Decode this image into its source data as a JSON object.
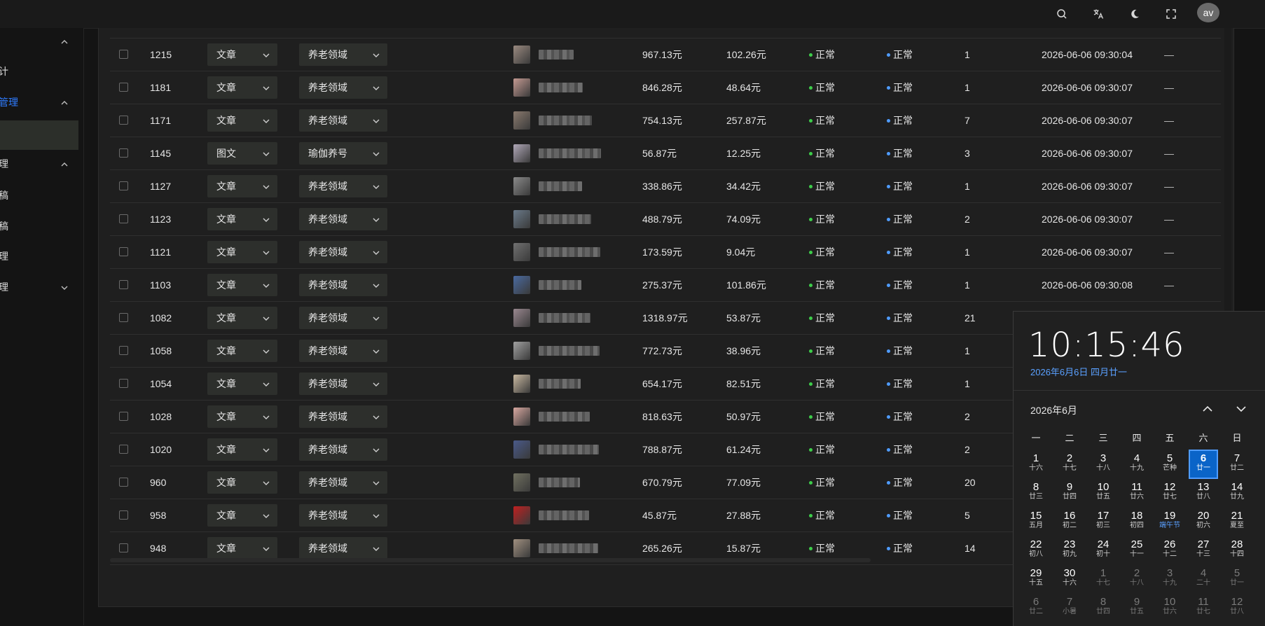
{
  "header": {
    "avatar_text": "av",
    "icons": [
      "search-icon",
      "translate-icon",
      "moon-icon",
      "fullscreen-icon"
    ]
  },
  "sidebar": {
    "items": [
      {
        "label": "",
        "chevron": "up"
      },
      {
        "label": "计",
        "chevron": ""
      },
      {
        "label": "管理",
        "chevron": "up",
        "active": true
      },
      {
        "label": "",
        "chevron": "",
        "selected": true
      },
      {
        "label": "理",
        "chevron": "up"
      },
      {
        "label": "稿",
        "chevron": ""
      },
      {
        "label": "稿",
        "chevron": ""
      },
      {
        "label": "理",
        "chevron": ""
      },
      {
        "label": "理",
        "chevron": "down"
      }
    ]
  },
  "table": {
    "rows": [
      {
        "id": "1215",
        "type": "文章",
        "domain": "养老领域",
        "price": "967.13元",
        "amount": "102.26元",
        "status1": "正常",
        "status2": "正常",
        "count": "1",
        "time": "2026-06-06 09:30:04",
        "extra": "—"
      },
      {
        "id": "1181",
        "type": "文章",
        "domain": "养老领域",
        "price": "846.28元",
        "amount": "48.64元",
        "status1": "正常",
        "status2": "正常",
        "count": "1",
        "time": "2026-06-06 09:30:07",
        "extra": "—"
      },
      {
        "id": "1171",
        "type": "文章",
        "domain": "养老领域",
        "price": "754.13元",
        "amount": "257.87元",
        "status1": "正常",
        "status2": "正常",
        "count": "7",
        "time": "2026-06-06 09:30:07",
        "extra": "—"
      },
      {
        "id": "1145",
        "type": "图文",
        "domain": "瑜伽养号",
        "price": "56.87元",
        "amount": "12.25元",
        "status1": "正常",
        "status2": "正常",
        "count": "3",
        "time": "2026-06-06 09:30:07",
        "extra": "—"
      },
      {
        "id": "1127",
        "type": "文章",
        "domain": "养老领域",
        "price": "338.86元",
        "amount": "34.42元",
        "status1": "正常",
        "status2": "正常",
        "count": "1",
        "time": "2026-06-06 09:30:07",
        "extra": "—"
      },
      {
        "id": "1123",
        "type": "文章",
        "domain": "养老领域",
        "price": "488.79元",
        "amount": "74.09元",
        "status1": "正常",
        "status2": "正常",
        "count": "2",
        "time": "2026-06-06 09:30:07",
        "extra": "—"
      },
      {
        "id": "1121",
        "type": "文章",
        "domain": "养老领域",
        "price": "173.59元",
        "amount": "9.04元",
        "status1": "正常",
        "status2": "正常",
        "count": "1",
        "time": "2026-06-06 09:30:07",
        "extra": "—"
      },
      {
        "id": "1103",
        "type": "文章",
        "domain": "养老领域",
        "price": "275.37元",
        "amount": "101.86元",
        "status1": "正常",
        "status2": "正常",
        "count": "1",
        "time": "2026-06-06 09:30:08",
        "extra": "—"
      },
      {
        "id": "1082",
        "type": "文章",
        "domain": "养老领域",
        "price": "1318.97元",
        "amount": "53.87元",
        "status1": "正常",
        "status2": "正常",
        "count": "21",
        "time": "",
        "extra": ""
      },
      {
        "id": "1058",
        "type": "文章",
        "domain": "养老领域",
        "price": "772.73元",
        "amount": "38.96元",
        "status1": "正常",
        "status2": "正常",
        "count": "1",
        "time": "",
        "extra": ""
      },
      {
        "id": "1054",
        "type": "文章",
        "domain": "养老领域",
        "price": "654.17元",
        "amount": "82.51元",
        "status1": "正常",
        "status2": "正常",
        "count": "1",
        "time": "",
        "extra": ""
      },
      {
        "id": "1028",
        "type": "文章",
        "domain": "养老领域",
        "price": "818.63元",
        "amount": "50.97元",
        "status1": "正常",
        "status2": "正常",
        "count": "2",
        "time": "",
        "extra": ""
      },
      {
        "id": "1020",
        "type": "文章",
        "domain": "养老领域",
        "price": "788.87元",
        "amount": "61.24元",
        "status1": "正常",
        "status2": "正常",
        "count": "2",
        "time": "",
        "extra": ""
      },
      {
        "id": "960",
        "type": "文章",
        "domain": "养老领域",
        "price": "670.79元",
        "amount": "77.09元",
        "status1": "正常",
        "status2": "正常",
        "count": "20",
        "time": "",
        "extra": ""
      },
      {
        "id": "958",
        "type": "文章",
        "domain": "养老领域",
        "price": "45.87元",
        "amount": "27.88元",
        "status1": "正常",
        "status2": "正常",
        "count": "5",
        "time": "",
        "extra": ""
      },
      {
        "id": "948",
        "type": "文章",
        "domain": "养老领域",
        "price": "265.26元",
        "amount": "15.87元",
        "status1": "正常",
        "status2": "正常",
        "count": "14",
        "time": "",
        "extra": ""
      }
    ],
    "thumb_colors": [
      "#9a8a80",
      "#c49a92",
      "#8a7a6e",
      "#b0a8b8",
      "#8a8a8a",
      "#6a7a8a",
      "#707070",
      "#4a6aa0",
      "#9a8890",
      "#a0a0a0",
      "#c8b8a0",
      "#d8a8a0",
      "#4a5a8a",
      "#707060",
      "#c02020",
      "#a09080"
    ],
    "status_colors": {
      "green": "#3dcc4a",
      "blue": "#4f9cff"
    }
  },
  "calendar": {
    "time": "10:15:46",
    "date_line": "2026年6月6日 四月廿一",
    "month_label": "2026年6月",
    "weekdays": [
      "一",
      "二",
      "三",
      "四",
      "五",
      "六",
      "日"
    ],
    "weeks": [
      [
        {
          "d": "1",
          "l": "十六"
        },
        {
          "d": "2",
          "l": "十七"
        },
        {
          "d": "3",
          "l": "十八"
        },
        {
          "d": "4",
          "l": "十九"
        },
        {
          "d": "5",
          "l": "芒种"
        },
        {
          "d": "6",
          "l": "廿一",
          "today": true
        },
        {
          "d": "7",
          "l": "廿二"
        }
      ],
      [
        {
          "d": "8",
          "l": "廿三"
        },
        {
          "d": "9",
          "l": "廿四"
        },
        {
          "d": "10",
          "l": "廿五"
        },
        {
          "d": "11",
          "l": "廿六"
        },
        {
          "d": "12",
          "l": "廿七"
        },
        {
          "d": "13",
          "l": "廿八"
        },
        {
          "d": "14",
          "l": "廿九"
        }
      ],
      [
        {
          "d": "15",
          "l": "五月"
        },
        {
          "d": "16",
          "l": "初二"
        },
        {
          "d": "17",
          "l": "初三"
        },
        {
          "d": "18",
          "l": "初四"
        },
        {
          "d": "19",
          "l": "端午节",
          "fest": true
        },
        {
          "d": "20",
          "l": "初六"
        },
        {
          "d": "21",
          "l": "夏至"
        }
      ],
      [
        {
          "d": "22",
          "l": "初八"
        },
        {
          "d": "23",
          "l": "初九"
        },
        {
          "d": "24",
          "l": "初十"
        },
        {
          "d": "25",
          "l": "十一"
        },
        {
          "d": "26",
          "l": "十二"
        },
        {
          "d": "27",
          "l": "十三"
        },
        {
          "d": "28",
          "l": "十四"
        }
      ],
      [
        {
          "d": "29",
          "l": "十五"
        },
        {
          "d": "30",
          "l": "十六"
        },
        {
          "d": "1",
          "l": "十七",
          "dim": true
        },
        {
          "d": "2",
          "l": "十八",
          "dim": true
        },
        {
          "d": "3",
          "l": "十九",
          "dim": true
        },
        {
          "d": "4",
          "l": "二十",
          "dim": true
        },
        {
          "d": "5",
          "l": "廿一",
          "dim": true
        }
      ],
      [
        {
          "d": "6",
          "l": "廿二",
          "dim": true
        },
        {
          "d": "7",
          "l": "小暑",
          "dim": true
        },
        {
          "d": "8",
          "l": "廿四",
          "dim": true
        },
        {
          "d": "9",
          "l": "廿五",
          "dim": true
        },
        {
          "d": "10",
          "l": "廿六",
          "dim": true
        },
        {
          "d": "11",
          "l": "廿七",
          "dim": true
        },
        {
          "d": "12",
          "l": "廿八",
          "dim": true
        }
      ]
    ]
  }
}
